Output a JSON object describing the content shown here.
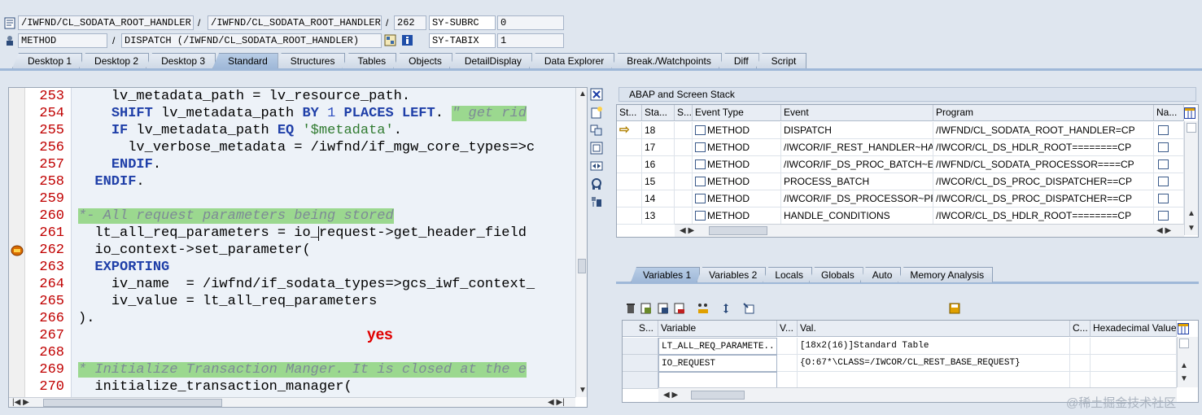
{
  "header": {
    "row1": {
      "field1": "/IWFND/CL_SODATA_ROOT_HANDLER...",
      "sep": "/",
      "field2": "/IWFND/CL_SODATA_ROOT_HANDLER...",
      "sep2": "/",
      "line": "262",
      "sysvar": "SY-SUBRC",
      "sysval": "0"
    },
    "row2": {
      "type": "METHOD",
      "sep": "/",
      "event": "DISPATCH (/IWFND/CL_SODATA_ROOT_HANDLER)",
      "sysvar": "SY-TABIX",
      "sysval": "1"
    }
  },
  "tabs": [
    {
      "label": "Desktop 1"
    },
    {
      "label": "Desktop 2"
    },
    {
      "label": "Desktop 3"
    },
    {
      "label": "Standard"
    },
    {
      "label": "Structures"
    },
    {
      "label": "Tables"
    },
    {
      "label": "Objects"
    },
    {
      "label": "DetailDisplay"
    },
    {
      "label": "Data Explorer"
    },
    {
      "label": "Break./Watchpoints"
    },
    {
      "label": "Diff"
    },
    {
      "label": "Script"
    }
  ],
  "code": {
    "line_numbers": [
      "253",
      "254",
      "255",
      "256",
      "257",
      "258",
      "259",
      "260",
      "261",
      "262",
      "263",
      "264",
      "265",
      "266",
      "267",
      "268",
      "269",
      "270"
    ],
    "lines": [
      {
        "i": "    ",
        "s": [
          [
            "t",
            "lv_metadata_path = lv_resource_path."
          ]
        ]
      },
      {
        "i": "    ",
        "s": [
          [
            "k",
            "SHIFT"
          ],
          [
            "t",
            " lv_metadata_path "
          ],
          [
            "k",
            "BY"
          ],
          [
            "t",
            " "
          ],
          [
            "n",
            "1"
          ],
          [
            "t",
            " "
          ],
          [
            "k",
            "PLACES LEFT"
          ],
          [
            "t",
            ". "
          ],
          [
            "c",
            "\" get rid"
          ]
        ]
      },
      {
        "i": "    ",
        "s": [
          [
            "k",
            "IF"
          ],
          [
            "t",
            " lv_metadata_path "
          ],
          [
            "k",
            "EQ"
          ],
          [
            "t",
            " "
          ],
          [
            "q",
            "'$metadata'"
          ],
          [
            "t",
            "."
          ]
        ]
      },
      {
        "i": "      ",
        "s": [
          [
            "t",
            "lv_verbose_metadata = /iwfnd/if_mgw_core_types=>c"
          ]
        ]
      },
      {
        "i": "    ",
        "s": [
          [
            "k",
            "ENDIF"
          ],
          [
            "t",
            "."
          ]
        ]
      },
      {
        "i": "  ",
        "s": [
          [
            "k",
            "ENDIF"
          ],
          [
            "t",
            "."
          ]
        ]
      },
      {
        "i": "",
        "s": []
      },
      {
        "i": "",
        "s": [
          [
            "c",
            "*- All request parameters being stored"
          ]
        ]
      },
      {
        "i": "  ",
        "s": [
          [
            "t",
            "lt_all_req_parameters = io_request->get_header_field"
          ]
        ]
      },
      {
        "i": "  ",
        "s": [
          [
            "t",
            "io_context->set_parameter("
          ]
        ]
      },
      {
        "i": "  ",
        "s": [
          [
            "k",
            "EXPORTING"
          ]
        ]
      },
      {
        "i": "    ",
        "s": [
          [
            "t",
            "iv_name  = /iwfnd/if_sodata_types=>gcs_iwf_context_"
          ]
        ]
      },
      {
        "i": "    ",
        "s": [
          [
            "t",
            "iv_value = lt_all_req_parameters"
          ]
        ]
      },
      {
        "i": "",
        "s": [
          [
            "t",
            ")."
          ]
        ]
      },
      {
        "i": "",
        "s": []
      },
      {
        "i": "",
        "s": []
      },
      {
        "i": "",
        "s": [
          [
            "c",
            "* Initialize Transaction Manger. It is closed at the e"
          ]
        ]
      },
      {
        "i": "  ",
        "s": [
          [
            "t",
            "initialize_transaction_manager("
          ]
        ]
      }
    ]
  },
  "annotation": "yes",
  "stack": {
    "title": "ABAP and Screen Stack",
    "columns": [
      "St...",
      "Sta...",
      "S...",
      "Event Type",
      "Event",
      "Program",
      "Na..."
    ],
    "rows": [
      {
        "level": "18",
        "type": "METHOD",
        "event": "DISPATCH",
        "program": "/IWFND/CL_SODATA_ROOT_HANDLER=CP",
        "current": true
      },
      {
        "level": "17",
        "type": "METHOD",
        "event": "/IWCOR/IF_REST_HANDLER~HA...",
        "program": "/IWCOR/CL_DS_HDLR_ROOT========CP",
        "current": false
      },
      {
        "level": "16",
        "type": "METHOD",
        "event": "/IWCOR/IF_DS_PROC_BATCH~E...",
        "program": "/IWFND/CL_SODATA_PROCESSOR====CP",
        "current": false
      },
      {
        "level": "15",
        "type": "METHOD",
        "event": "PROCESS_BATCH",
        "program": "/IWCOR/CL_DS_PROC_DISPATCHER==CP",
        "current": false
      },
      {
        "level": "14",
        "type": "METHOD",
        "event": "/IWCOR/IF_DS_PROCESSOR~PR...",
        "program": "/IWCOR/CL_DS_PROC_DISPATCHER==CP",
        "current": false
      },
      {
        "level": "13",
        "type": "METHOD",
        "event": "HANDLE_CONDITIONS",
        "program": "/IWCOR/CL_DS_HDLR_ROOT========CP",
        "current": false
      }
    ]
  },
  "var_tabs": [
    {
      "label": "Variables 1"
    },
    {
      "label": "Variables 2"
    },
    {
      "label": "Locals"
    },
    {
      "label": "Globals"
    },
    {
      "label": "Auto"
    },
    {
      "label": "Memory Analysis"
    }
  ],
  "variables": {
    "columns": [
      "S...",
      "Variable",
      "V...",
      "Val.",
      "C...",
      "Hexadecimal Value"
    ],
    "rows": [
      {
        "name": "LT_ALL_REQ_PARAMETE...",
        "value": "[18x2(16)]Standard Table"
      },
      {
        "name": "IO_REQUEST",
        "value": "{O:67*\\CLASS=/IWCOR/CL_REST_BASE_REQUEST}"
      },
      {
        "name": "",
        "value": ""
      }
    ]
  },
  "watermark": "@稀土掘金技术社区",
  "colors": {
    "accent": "#9fb8d8",
    "keyword": "#1f3fa8",
    "comment_bg": "#9bd88f",
    "line_number": "#c00000"
  }
}
